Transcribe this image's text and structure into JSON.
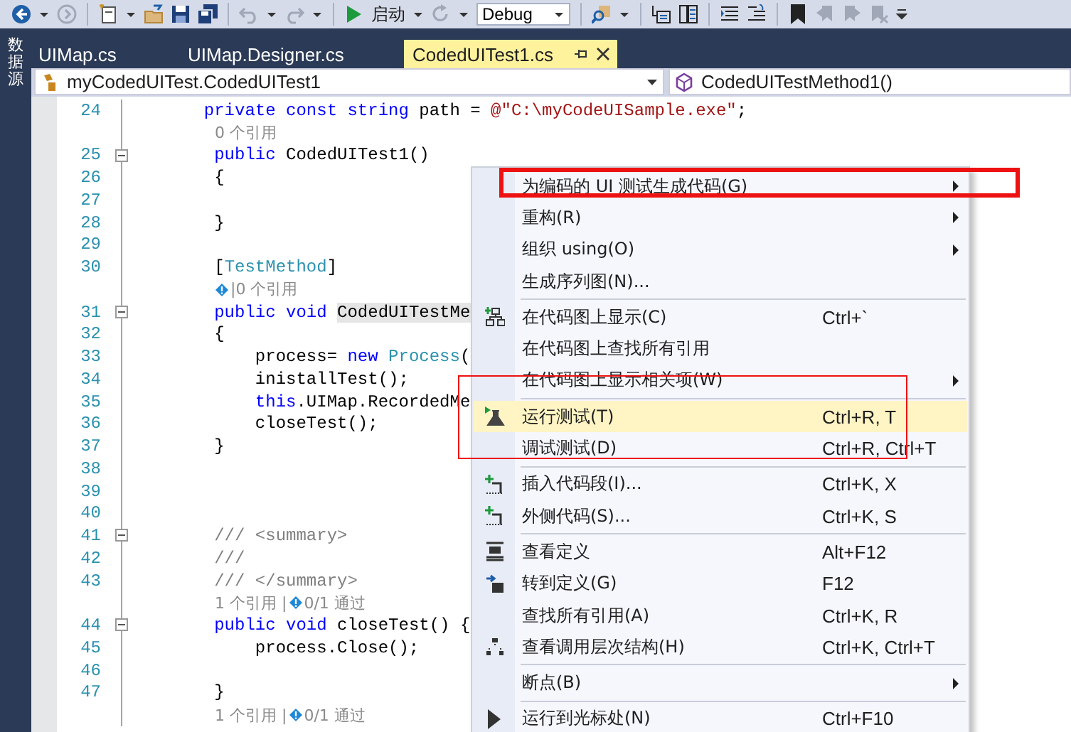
{
  "side_panel": {
    "title": "数据源"
  },
  "toolbar": {
    "start_label": "启动",
    "configuration": "Debug"
  },
  "tabs": [
    {
      "label": "UIMap.cs",
      "selected": false,
      "pinned": false
    },
    {
      "label": "UIMap.Designer.cs",
      "selected": false,
      "pinned": false
    },
    {
      "label": "CodedUITest1.cs",
      "selected": true,
      "pinned": true
    }
  ],
  "navigation": {
    "type_dropdown": "myCodedUITest.CodedUITest1",
    "member_dropdown": "CodedUITestMethod1()"
  },
  "code_lines": [
    {
      "kind": "code",
      "number": "24",
      "fold": false,
      "segments": [
        {
          "kind": "keyword",
          "text": "       private const string"
        },
        {
          "kind": "plain",
          "text": " path = "
        },
        {
          "kind": "string",
          "text": "@\"C:\\myCodeUISample.exe\""
        },
        {
          "kind": "plain",
          "text": ";"
        }
      ]
    },
    {
      "kind": "lens",
      "parts": [
        {
          "kind": "text",
          "text": "0 个引用"
        }
      ]
    },
    {
      "kind": "code",
      "number": "25",
      "fold": true,
      "segments": [
        {
          "kind": "keyword",
          "text": "        public"
        },
        {
          "kind": "plain",
          "text": " CodedUITest1()"
        }
      ]
    },
    {
      "kind": "code",
      "number": "26",
      "fold": false,
      "segments": [
        {
          "kind": "plain",
          "text": "        {"
        }
      ]
    },
    {
      "kind": "code",
      "number": "27",
      "fold": false
    },
    {
      "kind": "code",
      "number": "28",
      "fold": false,
      "segments": [
        {
          "kind": "plain",
          "text": "        }"
        }
      ]
    },
    {
      "kind": "code",
      "number": "29",
      "fold": false
    },
    {
      "kind": "code",
      "number": "30",
      "fold": false,
      "segments": [
        {
          "kind": "plain",
          "text": "        ["
        },
        {
          "kind": "type",
          "text": "TestMethod"
        },
        {
          "kind": "plain",
          "text": "]"
        }
      ]
    },
    {
      "kind": "lens",
      "parts": [
        {
          "kind": "icon"
        },
        {
          "kind": "text",
          "text": "|0 个引用"
        }
      ]
    },
    {
      "kind": "code",
      "number": "31",
      "fold": true,
      "segments": [
        {
          "kind": "keyword",
          "text": "        public void "
        },
        {
          "kind": "reference",
          "text": "CodedUITestMe"
        }
      ]
    },
    {
      "kind": "code",
      "number": "32",
      "fold": false,
      "segments": [
        {
          "kind": "plain",
          "text": "        {"
        }
      ]
    },
    {
      "kind": "code",
      "number": "33",
      "fold": false,
      "segments": [
        {
          "kind": "plain",
          "text": "            process= "
        },
        {
          "kind": "keyword",
          "text": "new "
        },
        {
          "kind": "type",
          "text": "Process"
        },
        {
          "kind": "plain",
          "text": "("
        }
      ]
    },
    {
      "kind": "code",
      "number": "34",
      "fold": false,
      "segments": [
        {
          "kind": "plain",
          "text": "            inistallTest();"
        }
      ]
    },
    {
      "kind": "code",
      "number": "35",
      "fold": false,
      "segments": [
        {
          "kind": "keyword",
          "text": "            this"
        },
        {
          "kind": "plain",
          "text": ".UIMap.RecordedMe"
        }
      ]
    },
    {
      "kind": "code",
      "number": "36",
      "fold": false,
      "segments": [
        {
          "kind": "plain",
          "text": "            closeTest();"
        }
      ]
    },
    {
      "kind": "code",
      "number": "37",
      "fold": false,
      "segments": [
        {
          "kind": "plain",
          "text": "        }"
        }
      ]
    },
    {
      "kind": "code",
      "number": "38",
      "fold": false
    },
    {
      "kind": "code",
      "number": "39",
      "fold": false
    },
    {
      "kind": "code",
      "number": "40",
      "fold": false
    },
    {
      "kind": "code",
      "number": "41",
      "fold": true,
      "segments": [
        {
          "kind": "comment",
          "text": "        /// <summary>"
        }
      ]
    },
    {
      "kind": "code",
      "number": "42",
      "fold": false,
      "segments": [
        {
          "kind": "comment",
          "text": "        ///"
        }
      ]
    },
    {
      "kind": "code",
      "number": "43",
      "fold": false,
      "segments": [
        {
          "kind": "comment",
          "text": "        /// </summary>"
        }
      ]
    },
    {
      "kind": "lens",
      "parts": [
        {
          "kind": "text",
          "text": "1 个引用 |"
        },
        {
          "kind": "icon"
        },
        {
          "kind": "text",
          "text": "0/1 通过"
        }
      ]
    },
    {
      "kind": "code",
      "number": "44",
      "fold": true,
      "segments": [
        {
          "kind": "keyword",
          "text": "        public void"
        },
        {
          "kind": "plain",
          "text": " closeTest() {"
        }
      ]
    },
    {
      "kind": "code",
      "number": "45",
      "fold": false,
      "segments": [
        {
          "kind": "plain",
          "text": "            process.Close();"
        }
      ]
    },
    {
      "kind": "code",
      "number": "46",
      "fold": false
    },
    {
      "kind": "code",
      "number": "47",
      "fold": false,
      "segments": [
        {
          "kind": "plain",
          "text": "        }"
        }
      ]
    },
    {
      "kind": "lens",
      "parts": [
        {
          "kind": "text",
          "text": "1 个引用 |"
        },
        {
          "kind": "icon"
        },
        {
          "kind": "text",
          "text": "0/1 通过"
        }
      ]
    }
  ],
  "context_menu": {
    "groups": [
      {
        "items": [
          {
            "label": "为编码的 UI 测试生成代码(G)",
            "submenu": true,
            "selected": false,
            "outlined": true,
            "heavy_outline": true
          },
          {
            "label": "重构(R)",
            "submenu": true,
            "selected": false,
            "outlined": false
          },
          {
            "label": "组织 using(O)",
            "submenu": true,
            "selected": false,
            "outlined": false
          },
          {
            "label": "生成序列图(N)...",
            "submenu": false,
            "selected": false,
            "outlined": false
          }
        ]
      },
      {
        "items": [
          {
            "label": "在代码图上显示(C)",
            "shortcut": "Ctrl+`",
            "submenu": false,
            "selected": false,
            "outlined": false
          },
          {
            "label": "在代码图上查找所有引用",
            "submenu": false,
            "selected": false,
            "outlined": false
          },
          {
            "label": "在代码图上显示相关项(W)",
            "submenu": true,
            "selected": false,
            "outlined": false
          }
        ]
      },
      {
        "items": [
          {
            "label": "运行测试(T)",
            "shortcut": "Ctrl+R, T",
            "submenu": false,
            "selected": true,
            "outlined": true,
            "heavy_outline": false
          },
          {
            "label": "调试测试(D)",
            "shortcut": "Ctrl+R, Ctrl+T",
            "submenu": false,
            "selected": false,
            "outlined": true
          }
        ]
      },
      {
        "items": [
          {
            "label": "插入代码段(I)...",
            "shortcut": "Ctrl+K, X",
            "submenu": false,
            "selected": false,
            "outlined": false
          },
          {
            "label": "外侧代码(S)...",
            "shortcut": "Ctrl+K, S",
            "submenu": false,
            "selected": false,
            "outlined": false
          }
        ]
      },
      {
        "items": [
          {
            "label": "查看定义",
            "shortcut": "Alt+F12",
            "submenu": false,
            "selected": false,
            "outlined": false
          },
          {
            "label": "转到定义(G)",
            "shortcut": "F12",
            "submenu": false,
            "selected": false,
            "outlined": false
          },
          {
            "label": "查找所有引用(A)",
            "shortcut": "Ctrl+K, R",
            "submenu": false,
            "selected": false,
            "outlined": false
          },
          {
            "label": "查看调用层次结构(H)",
            "shortcut": "Ctrl+K, Ctrl+T",
            "submenu": false,
            "selected": false,
            "outlined": false
          }
        ]
      },
      {
        "items": [
          {
            "label": "断点(B)",
            "submenu": true,
            "selected": false,
            "outlined": false
          }
        ]
      },
      {
        "items": [
          {
            "label": "运行到光标处(N)",
            "shortcut": "Ctrl+F10",
            "submenu": false,
            "selected": false,
            "outlined": false
          }
        ]
      }
    ]
  }
}
